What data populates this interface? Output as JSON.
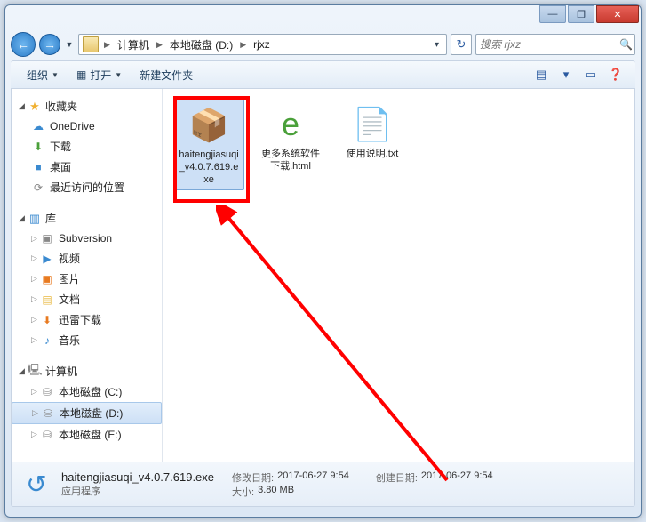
{
  "titlebar": {
    "min": "—",
    "max": "❐",
    "close": "✕"
  },
  "breadcrumb": {
    "items": [
      "计算机",
      "本地磁盘 (D:)",
      "rjxz"
    ]
  },
  "search": {
    "placeholder": "搜索 rjxz"
  },
  "toolbar": {
    "organize": "组织",
    "open": "打开",
    "newfolder": "新建文件夹"
  },
  "sidebar": {
    "favorites": {
      "label": "收藏夹",
      "items": [
        {
          "icon": "☁",
          "label": "OneDrive",
          "cls": "ic-blue"
        },
        {
          "icon": "⬇",
          "label": "下载",
          "cls": "ic-green"
        },
        {
          "icon": "■",
          "label": "桌面",
          "cls": "ic-blue"
        },
        {
          "icon": "⟳",
          "label": "最近访问的位置",
          "cls": "ic-gray"
        }
      ]
    },
    "libraries": {
      "label": "库",
      "items": [
        {
          "icon": "▣",
          "label": "Subversion",
          "cls": "ic-gray",
          "nest": true
        },
        {
          "icon": "▶",
          "label": "视频",
          "cls": "ic-blue",
          "nest": true
        },
        {
          "icon": "▣",
          "label": "图片",
          "cls": "ic-orange",
          "nest": true
        },
        {
          "icon": "▤",
          "label": "文档",
          "cls": "ic-folder",
          "nest": true
        },
        {
          "icon": "⬇",
          "label": "迅雷下载",
          "cls": "ic-orange",
          "nest": true
        },
        {
          "icon": "♪",
          "label": "音乐",
          "cls": "ic-blue",
          "nest": true
        }
      ]
    },
    "computer": {
      "label": "计算机",
      "items": [
        {
          "icon": "⛁",
          "label": "本地磁盘 (C:)",
          "cls": "ic-gray",
          "nest": true
        },
        {
          "icon": "⛁",
          "label": "本地磁盘 (D:)",
          "cls": "ic-gray",
          "nest": true,
          "selected": true
        },
        {
          "icon": "⛁",
          "label": "本地磁盘 (E:)",
          "cls": "ic-gray",
          "nest": true
        }
      ]
    }
  },
  "files": [
    {
      "name": "haitengjiasuqi_v4.0.7.619.exe",
      "icon": "📦",
      "selected": true
    },
    {
      "name": "更多系统软件下载.html",
      "icon": "e",
      "iconcls": "ic-green"
    },
    {
      "name": "使用说明.txt",
      "icon": "📄"
    }
  ],
  "status": {
    "filename": "haitengjiasuqi_v4.0.7.619.exe",
    "filetype": "应用程序",
    "mod_label": "修改日期:",
    "mod_value": "2017-06-27 9:54",
    "size_label": "大小:",
    "size_value": "3.80 MB",
    "create_label": "创建日期:",
    "create_value": "2017-06-27 9:54"
  }
}
